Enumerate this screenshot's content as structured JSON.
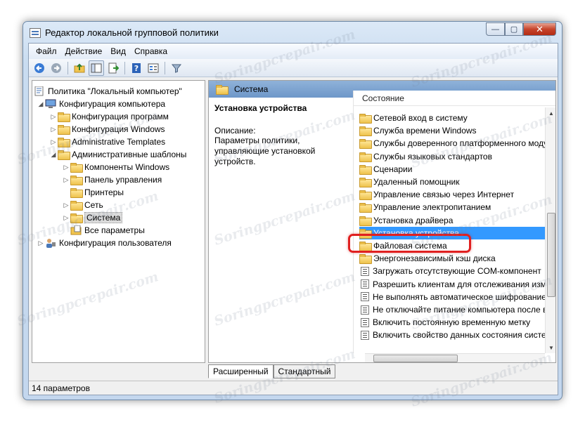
{
  "window": {
    "title": "Редактор локальной групповой политики",
    "min_glyph": "—",
    "max_glyph": "▢",
    "close_glyph": "✕"
  },
  "menu": [
    {
      "label": "Файл"
    },
    {
      "label": "Действие"
    },
    {
      "label": "Вид"
    },
    {
      "label": "Справка"
    }
  ],
  "toolbar": {
    "buttons": [
      "back-icon",
      "forward-icon",
      "up-folder-icon",
      "show-hide-tree-icon",
      "export-list-icon",
      "help-icon",
      "properties-icon",
      "filter-icon"
    ]
  },
  "tree": {
    "root": "Политика \"Локальный компьютер\"",
    "computer_config": "Конфигурация компьютера",
    "software_config": "Конфигурация программ",
    "windows_config": "Конфигурация Windows",
    "admin_templates_en": "Administrative Templates",
    "admin_templates": "Административные шаблоны",
    "windows_components": "Компоненты Windows",
    "control_panel": "Панель управления",
    "printers": "Принтеры",
    "network": "Сеть",
    "system": "Система",
    "all_settings": "Все параметры",
    "user_config": "Конфигурация пользователя"
  },
  "main": {
    "header": "Система",
    "selected_title": "Установка устройства",
    "desc_label": "Описание:",
    "desc_text": "Параметры политики, управляющие установкой устройств.",
    "column_header": "Состояние",
    "items": [
      {
        "label": "Сетевой вход в систему",
        "kind": "folder"
      },
      {
        "label": "Служба времени Windows",
        "kind": "folder"
      },
      {
        "label": "Службы доверенного платформенного моду",
        "kind": "folder"
      },
      {
        "label": "Службы языковых стандартов",
        "kind": "folder"
      },
      {
        "label": "Сценарии",
        "kind": "folder"
      },
      {
        "label": "Удаленный помощник",
        "kind": "folder"
      },
      {
        "label": "Управление связью через Интернет",
        "kind": "folder"
      },
      {
        "label": "Управление электропитанием",
        "kind": "folder"
      },
      {
        "label": "Установка драйвера",
        "kind": "folder"
      },
      {
        "label": "Установка устройства",
        "kind": "folder",
        "selected": true
      },
      {
        "label": "Файловая система",
        "kind": "folder"
      },
      {
        "label": "Энергонезависимый кэш диска",
        "kind": "folder"
      },
      {
        "label": "Загружать отсутствующие COM-компонент",
        "kind": "setting"
      },
      {
        "label": "Разрешить клиентам для отслеживания изме",
        "kind": "setting"
      },
      {
        "label": "Не выполнять автоматическое шифрование",
        "kind": "setting"
      },
      {
        "label": "Не отключайте питание компьютера после в",
        "kind": "setting"
      },
      {
        "label": "Включить постоянную временную метку",
        "kind": "setting"
      },
      {
        "label": "Включить свойство данных состояния систем",
        "kind": "setting"
      }
    ]
  },
  "tabs": [
    {
      "label": "Расширенный",
      "active": true
    },
    {
      "label": "Стандартный",
      "active": false
    }
  ],
  "status": "14 параметров",
  "watermark": "Soringpcrepair.com",
  "colors": {
    "selection": "#3399ff",
    "highlight": "#e02020",
    "header": "#7aa0cf"
  }
}
